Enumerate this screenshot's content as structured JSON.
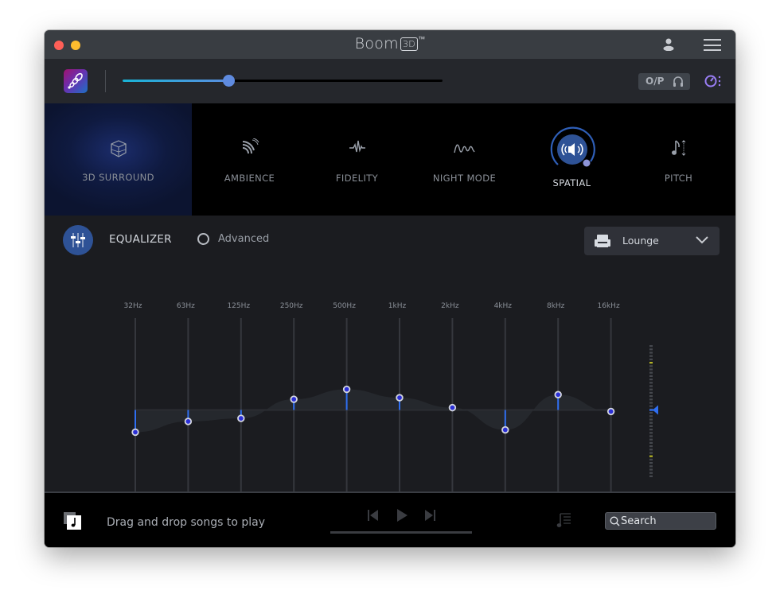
{
  "window": {
    "title": "Boom",
    "title_badge": "3D",
    "title_tm": "™"
  },
  "topbar": {
    "volume_fraction": 0.33,
    "output_button_label": "O/P"
  },
  "modes": [
    {
      "id": "3d-surround",
      "label": "3D SURROUND",
      "icon": "cube-icon",
      "selected_bg": true
    },
    {
      "id": "ambience",
      "label": "AMBIENCE",
      "icon": "waves-icon"
    },
    {
      "id": "fidelity",
      "label": "FIDELITY",
      "icon": "pulse-icon"
    },
    {
      "id": "night-mode",
      "label": "NIGHT MODE",
      "icon": "wave-icon"
    },
    {
      "id": "spatial",
      "label": "SPATIAL",
      "icon": "speaker-icon",
      "active": true
    },
    {
      "id": "pitch",
      "label": "PITCH",
      "icon": "note-pitch-icon"
    }
  ],
  "equalizer": {
    "title": "EQUALIZER",
    "advanced_label": "Advanced",
    "advanced_checked": false,
    "preset": "Lounge",
    "accent": "#2f6ef0",
    "gain_range_db": [
      -12,
      12
    ],
    "preamp_db": 0
  },
  "chart_data": {
    "type": "line",
    "title": "EQUALIZER",
    "categories": [
      "32Hz",
      "63Hz",
      "125Hz",
      "250Hz",
      "500Hz",
      "1kHz",
      "2kHz",
      "4kHz",
      "8kHz",
      "16kHz"
    ],
    "series": [
      {
        "name": "Lounge",
        "values": [
          -2.9,
          -1.5,
          -1.1,
          1.4,
          2.7,
          1.6,
          0.3,
          -2.6,
          2.0,
          -0.2
        ]
      }
    ],
    "ylim": [
      -12,
      12
    ],
    "xlabel": "",
    "ylabel": "",
    "grid": false
  },
  "player": {
    "drop_text": "Drag and drop songs to play",
    "search_placeholder": "Search"
  }
}
